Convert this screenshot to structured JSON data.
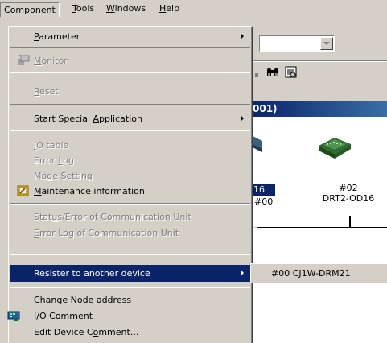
{
  "menubar": {
    "items": [
      {
        "label": "Component",
        "accel": "C",
        "rest": "omponent"
      },
      {
        "label": "Tools",
        "accel": "T",
        "rest": "ools"
      },
      {
        "label": "Windows",
        "accel": "W",
        "rest": "indows"
      },
      {
        "label": "Help",
        "accel": "H",
        "rest": "elp"
      }
    ]
  },
  "menu": {
    "parameter": {
      "pre": "",
      "accel": "P",
      "post": "arameter"
    },
    "monitor": {
      "pre": "",
      "accel": "M",
      "post": "onitor"
    },
    "reset": {
      "pre": "",
      "accel": "R",
      "post": "eset"
    },
    "start_special": {
      "pre": "Start Special ",
      "accel": "A",
      "post": "pplication"
    },
    "io_table": {
      "pre": "",
      "accel": "I",
      "post": "O table"
    },
    "error_log": {
      "pre": "Error ",
      "accel": "L",
      "post": "og"
    },
    "mode_setting": {
      "pre": "Mo",
      "accel": "d",
      "post": "e Setting"
    },
    "maintenance": {
      "pre": "",
      "accel": "M",
      "post": "aintenance information"
    },
    "status_error": {
      "pre": "Stat",
      "accel": "u",
      "post": "s/Error of Communication Unit"
    },
    "error_log_comm": {
      "pre": "",
      "accel": "E",
      "post": "rror Log of Communication Unit"
    },
    "resister": {
      "pre": "Resister to another device",
      "accel": "",
      "post": ""
    },
    "change_node": {
      "pre": "Change Node ",
      "accel": "a",
      "post": "ddress"
    },
    "io_comment": {
      "pre": "I/O ",
      "accel": "C",
      "post": "omment"
    },
    "edit_device_comment": {
      "pre": "Edit Device C",
      "accel": "o",
      "post": "mment..."
    }
  },
  "submenu": {
    "item": "#00 CJ1W-DRM21"
  },
  "background": {
    "title_fragment": "001)",
    "device1_label": "16",
    "device1_node": "#00",
    "device2_node": "#02",
    "device2_model": "DRT2-OD16"
  },
  "colors": {
    "highlight": "#0a246a",
    "face": "#d4d0c8",
    "disabled": "#808080"
  },
  "icons": {
    "monitor": "monitor-icon",
    "maintenance": "maintenance-icon",
    "io_comment": "io-comment-icon",
    "find": "binoculars-icon",
    "properties": "properties-icon"
  }
}
